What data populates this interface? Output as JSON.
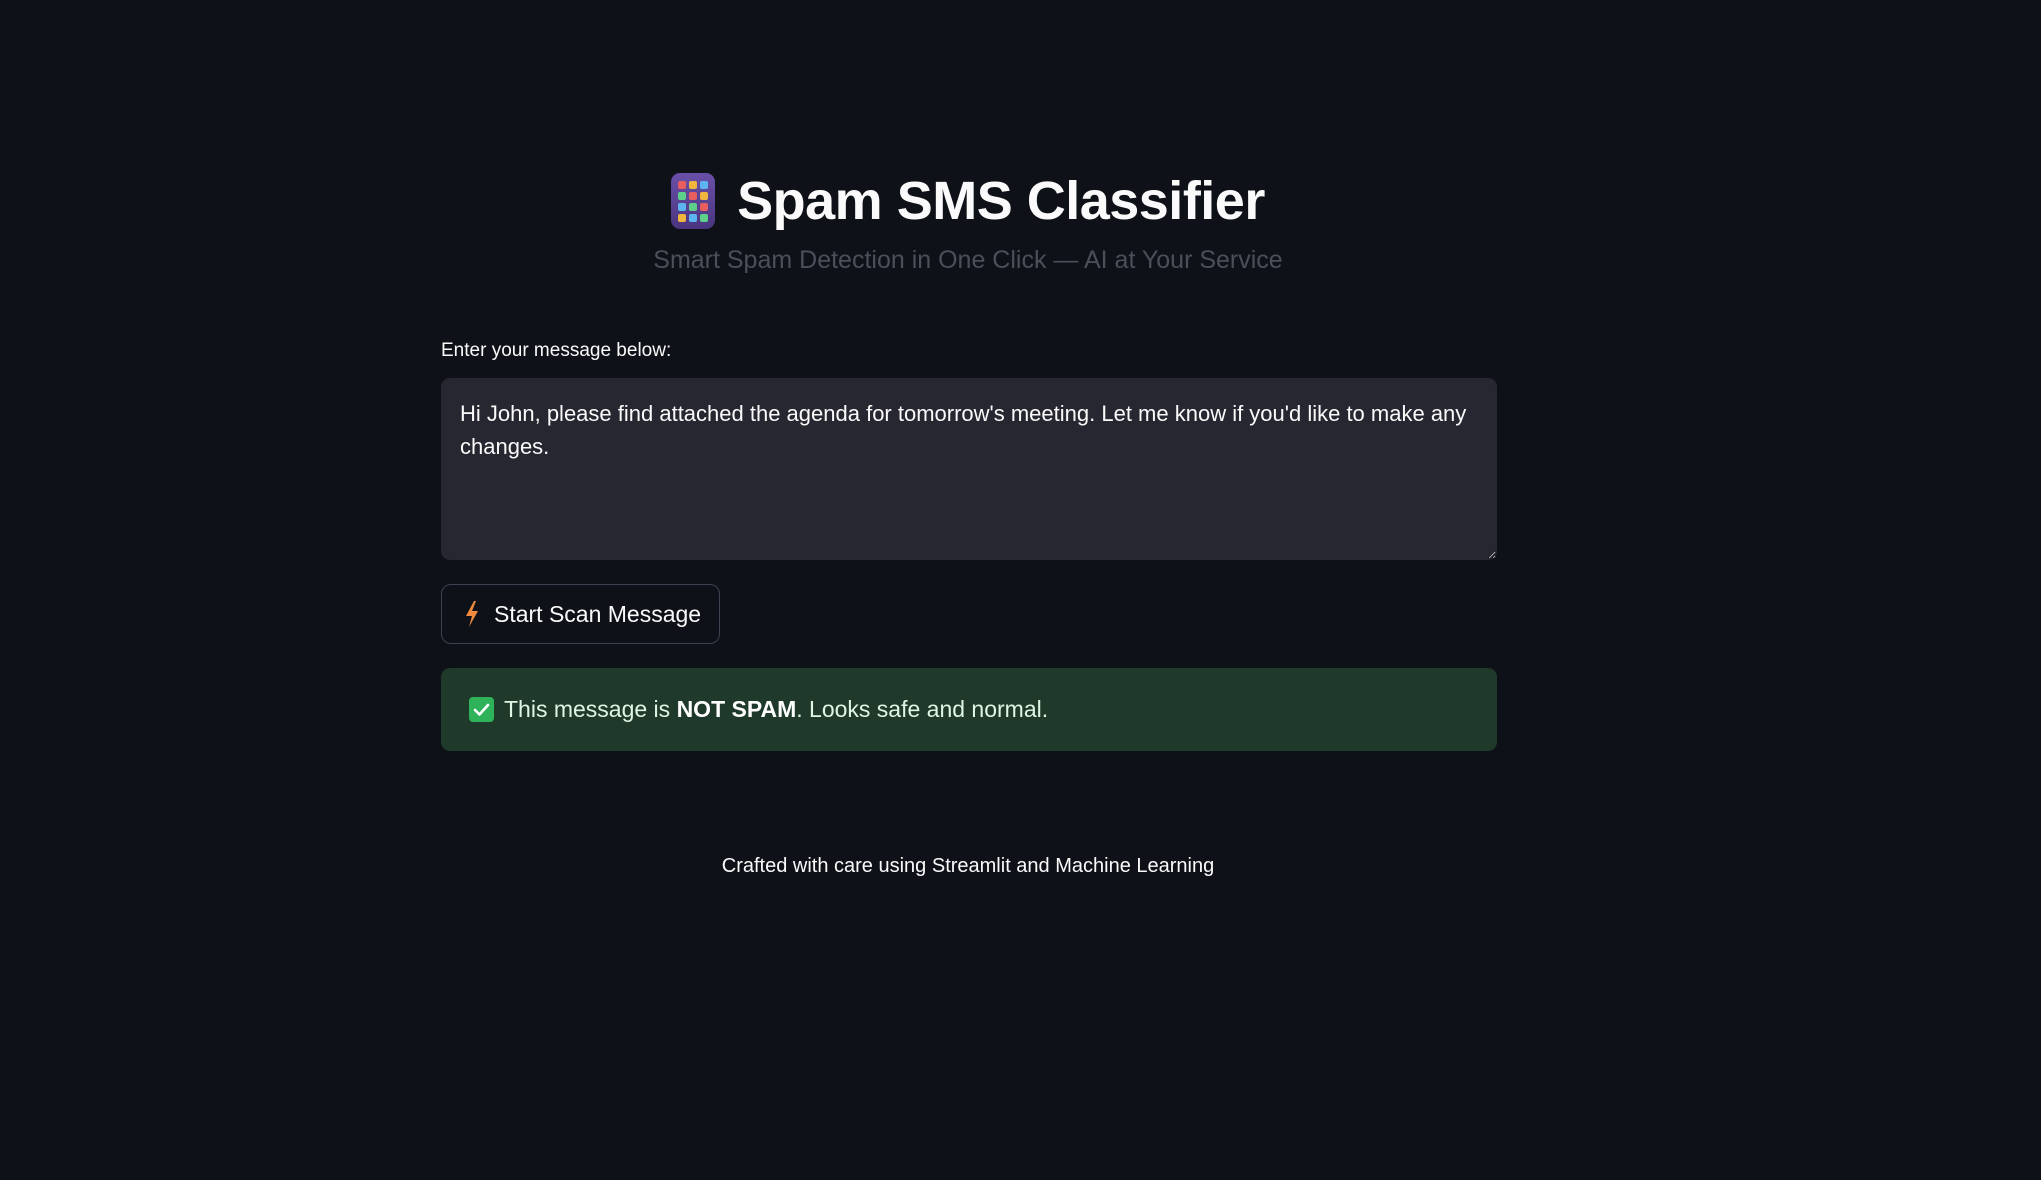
{
  "header": {
    "app_icon": "calculator-icon",
    "title": "Spam SMS Classifier",
    "subtitle": "Smart Spam Detection in One Click — AI at Your Service"
  },
  "form": {
    "label": "Enter your message below:",
    "message_value": "Hi John, please find attached the agenda for tomorrow's meeting. Let me know if you'd like to make any changes.",
    "button_icon": "lightning-bolt-icon",
    "button_label": "Start Scan Message"
  },
  "result": {
    "icon": "check-mark-icon",
    "prefix": "This message is ",
    "verdict": "NOT SPAM",
    "suffix": ". Looks safe and normal.",
    "status_color": "#1f3a2a"
  },
  "footer": {
    "text": "Crafted with care using Streamlit and Machine Learning"
  },
  "colors": {
    "background": "#0e1117",
    "input_background": "#262730",
    "accent_bolt": "#f08a3e",
    "success": "#2fb35a"
  }
}
